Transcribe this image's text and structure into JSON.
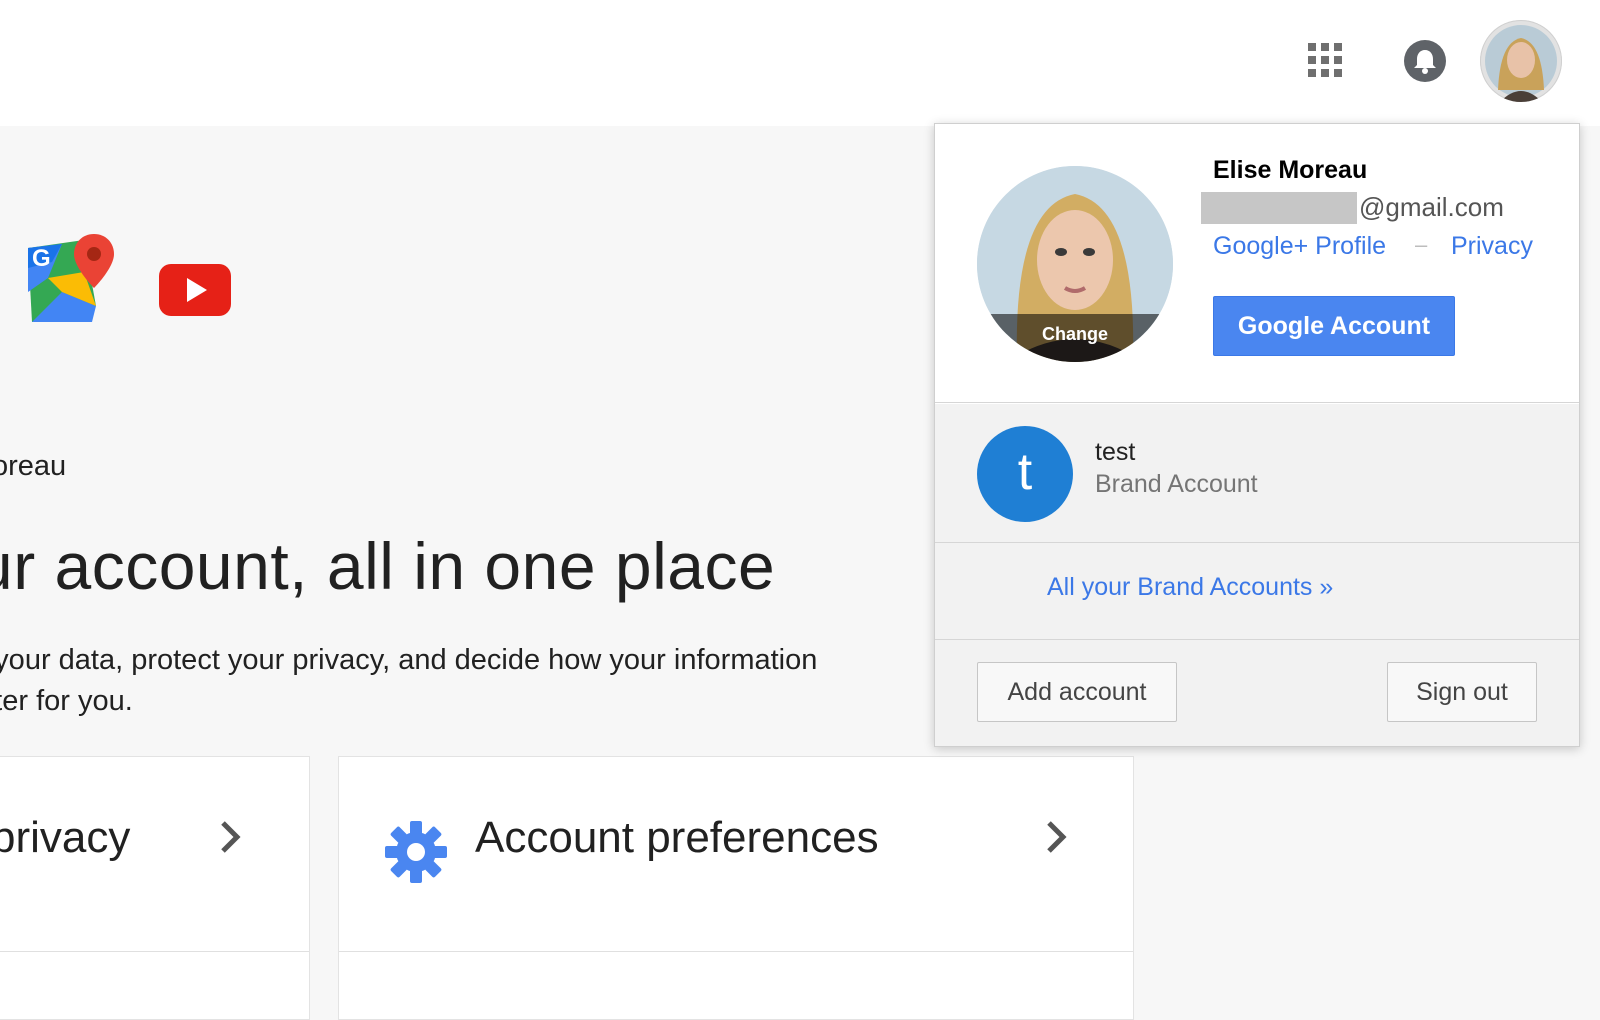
{
  "header": {
    "apps_icon": "apps-grid-icon",
    "notifications_icon": "bell-icon",
    "avatar_icon": "profile-avatar-icon"
  },
  "main": {
    "product_logos": [
      "google-maps-logo",
      "youtube-logo"
    ],
    "user_name_partial": "oreau",
    "title": "ur account, all in one place",
    "description_line1": "d your data, protect your privacy, and decide how your information",
    "description_line2": "etter for you.",
    "cards": [
      {
        "title": "privacy",
        "icon": "chevron-right-icon"
      },
      {
        "title": "Account preferences",
        "icon": "gear-icon"
      }
    ]
  },
  "account_menu": {
    "name": "Elise Moreau",
    "email_domain": "@gmail.com",
    "change_label": "Change",
    "profile_link": "Google+ Profile",
    "separator": "–",
    "privacy_link": "Privacy",
    "google_account_button": "Google Account",
    "brand_account": {
      "initial": "t",
      "name": "test",
      "type": "Brand Account"
    },
    "all_brand_accounts_link": "All your Brand Accounts »",
    "add_account_button": "Add account",
    "sign_out_button": "Sign out"
  },
  "colors": {
    "link_blue": "#3b78e7",
    "primary_button": "#4a86f0",
    "brand_avatar": "#1f7fd4",
    "gear_blue": "#4a86f0"
  }
}
